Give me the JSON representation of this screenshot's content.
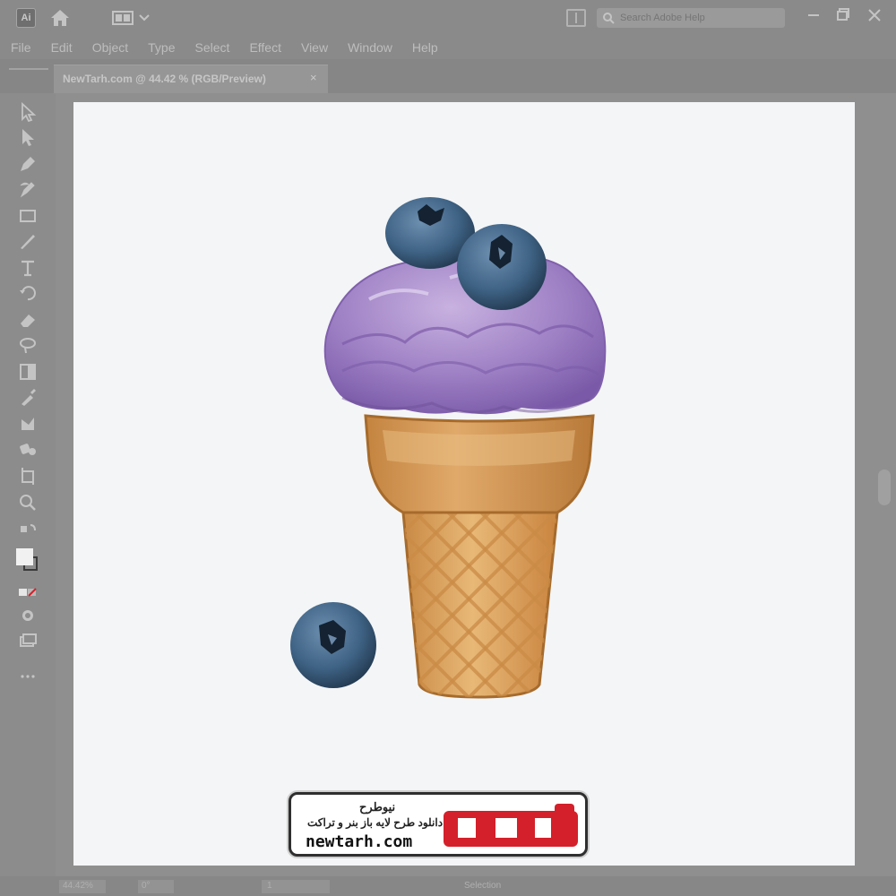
{
  "app": {
    "logo_text": "Ai",
    "search_placeholder": "Search Adobe Help"
  },
  "menu": [
    "File",
    "Edit",
    "Object",
    "Type",
    "Select",
    "Effect",
    "View",
    "Window",
    "Help"
  ],
  "document_tab": {
    "label": "NewTarh.com @ 44.42 % (RGB/Preview)",
    "close_glyph": "×"
  },
  "status": {
    "zoom": "44.42%",
    "rotation": "0°",
    "page": "1",
    "tool": "Selection"
  },
  "watermark": {
    "name": "نیوطرح",
    "tagline": "دانلود طرح لایه باز بنر و تراکت",
    "domain": "newtarh.com",
    "logo_text": "نیوطرح"
  },
  "icons": [
    "illustrator-logo-icon",
    "home-icon",
    "workspace-switcher-icon",
    "arrange-documents-icon",
    "search-icon",
    "minimize-icon",
    "maximize-icon",
    "close-icon"
  ],
  "tools": [
    "selection-tool-icon",
    "direct-selection-tool-icon",
    "pen-tool-icon",
    "curvature-tool-icon",
    "rectangle-tool-icon",
    "paintbrush-tool-icon",
    "type-tool-icon",
    "rotate-tool-icon",
    "eraser-tool-icon",
    "lasso-tool-icon",
    "gradient-tool-icon",
    "eyedropper-tool-icon",
    "shape-builder-tool-icon",
    "blend-tool-icon",
    "artboard-tool-icon",
    "zoom-tool-icon",
    "default-colors-icon",
    "fill-stroke-icon",
    "color-mode-icon",
    "drawing-mode-icon",
    "screen-mode-icon",
    "more-tools-icon"
  ],
  "colors": {
    "accent_red": "#d4202a",
    "cream": "#f4f5f6",
    "icecream_purple": "#9b80bf",
    "blueberry": "#3d5f7e",
    "cone": "#d9a25c"
  }
}
